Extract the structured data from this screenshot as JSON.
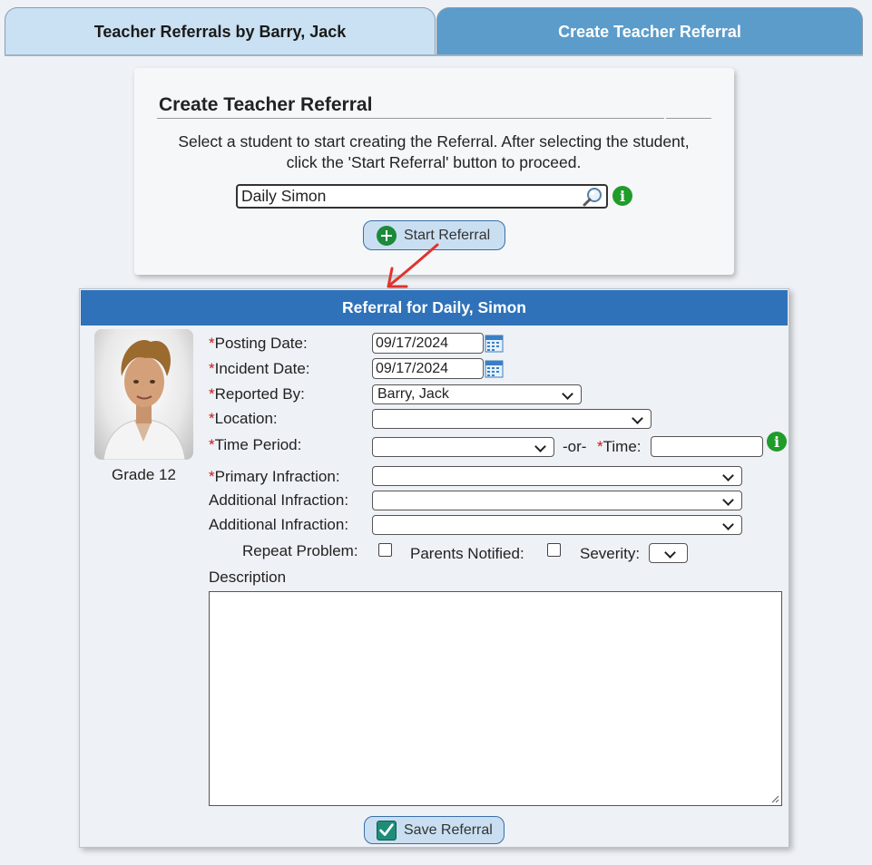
{
  "tabs": [
    {
      "label": "Teacher Referrals by Barry, Jack"
    },
    {
      "label": "Create Teacher Referral"
    }
  ],
  "create": {
    "title": "Create Teacher Referral",
    "description": "Select a student to start creating the Referral. After selecting the student, click the 'Start Referral' button to proceed.",
    "search_value": "Daily Simon",
    "start_label": "Start Referral"
  },
  "referral": {
    "header": "Referral for Daily, Simon",
    "grade": "Grade 12",
    "required_mark": "*",
    "posting_date_label": "Posting Date:",
    "posting_date": "09/17/2024",
    "incident_date_label": "Incident Date:",
    "incident_date": "09/17/2024",
    "reported_by_label": "Reported By:",
    "reported_by": "Barry, Jack",
    "location_label": "Location:",
    "location": "",
    "time_period_label": "Time Period:",
    "time_period": "",
    "or_label": "-or-",
    "time_label": "Time:",
    "time_value": "",
    "primary_infraction_label": "Primary Infraction:",
    "primary_infraction": "",
    "additional_infraction_label": "Additional Infraction:",
    "additional_infraction_1": "",
    "additional_infraction_2": "",
    "repeat_problem_label": "Repeat Problem:",
    "parents_notified_label": "Parents Notified:",
    "severity_label": "Severity:",
    "severity": "",
    "description_label": "Description",
    "save_label": "Save Referral"
  },
  "colors": {
    "header_blue": "#2f72b9",
    "tab_active": "#5b9ccb",
    "tab_inactive": "#c9e1f2",
    "required_red": "#d01515",
    "info_green": "#1f9c2a"
  }
}
